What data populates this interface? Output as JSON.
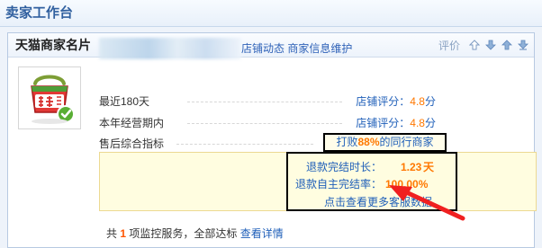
{
  "workbench": {
    "title": "卖家工作台"
  },
  "card": {
    "title": "天猫商家名片",
    "rate_label": "评价",
    "controls": [
      "up-arrow-outline",
      "down-arrow",
      "up-arrow",
      "down-arrow"
    ]
  },
  "shop": {
    "links": {
      "shop_dynamic": "店铺动态",
      "merchant_info": "商家信息维护"
    },
    "metrics": [
      {
        "label": "最近180天",
        "score_label": "店铺评分：",
        "score_value": "4.8",
        "unit": "分"
      },
      {
        "label": "本年经营期内",
        "score_label": "店铺评分：",
        "score_value": "4.8",
        "unit": "分"
      }
    ],
    "after_sales": {
      "label": "售后综合指标",
      "beat_prefix": "打败",
      "beat_percent": "88%",
      "beat_suffix": "的同行商家"
    },
    "refund": {
      "duration_label": "退款完结时长：",
      "duration_value": "1.23",
      "duration_unit": "天",
      "self_completion_label": "退款自主完结率：",
      "self_completion_value": "100.00%",
      "more_link": "点击查看更多客服数据"
    }
  },
  "footer": {
    "prefix": "共",
    "service_count": "1",
    "middle": "项监控服务，全部达标",
    "detail_link": "查看详情"
  },
  "colors": {
    "brand_blue": "#2f5f9f",
    "link_blue": "#1f5fb9",
    "highlight_orange": "#ff7800",
    "annotation_red": "#f02020",
    "callout_yellow": "#fffde0"
  }
}
